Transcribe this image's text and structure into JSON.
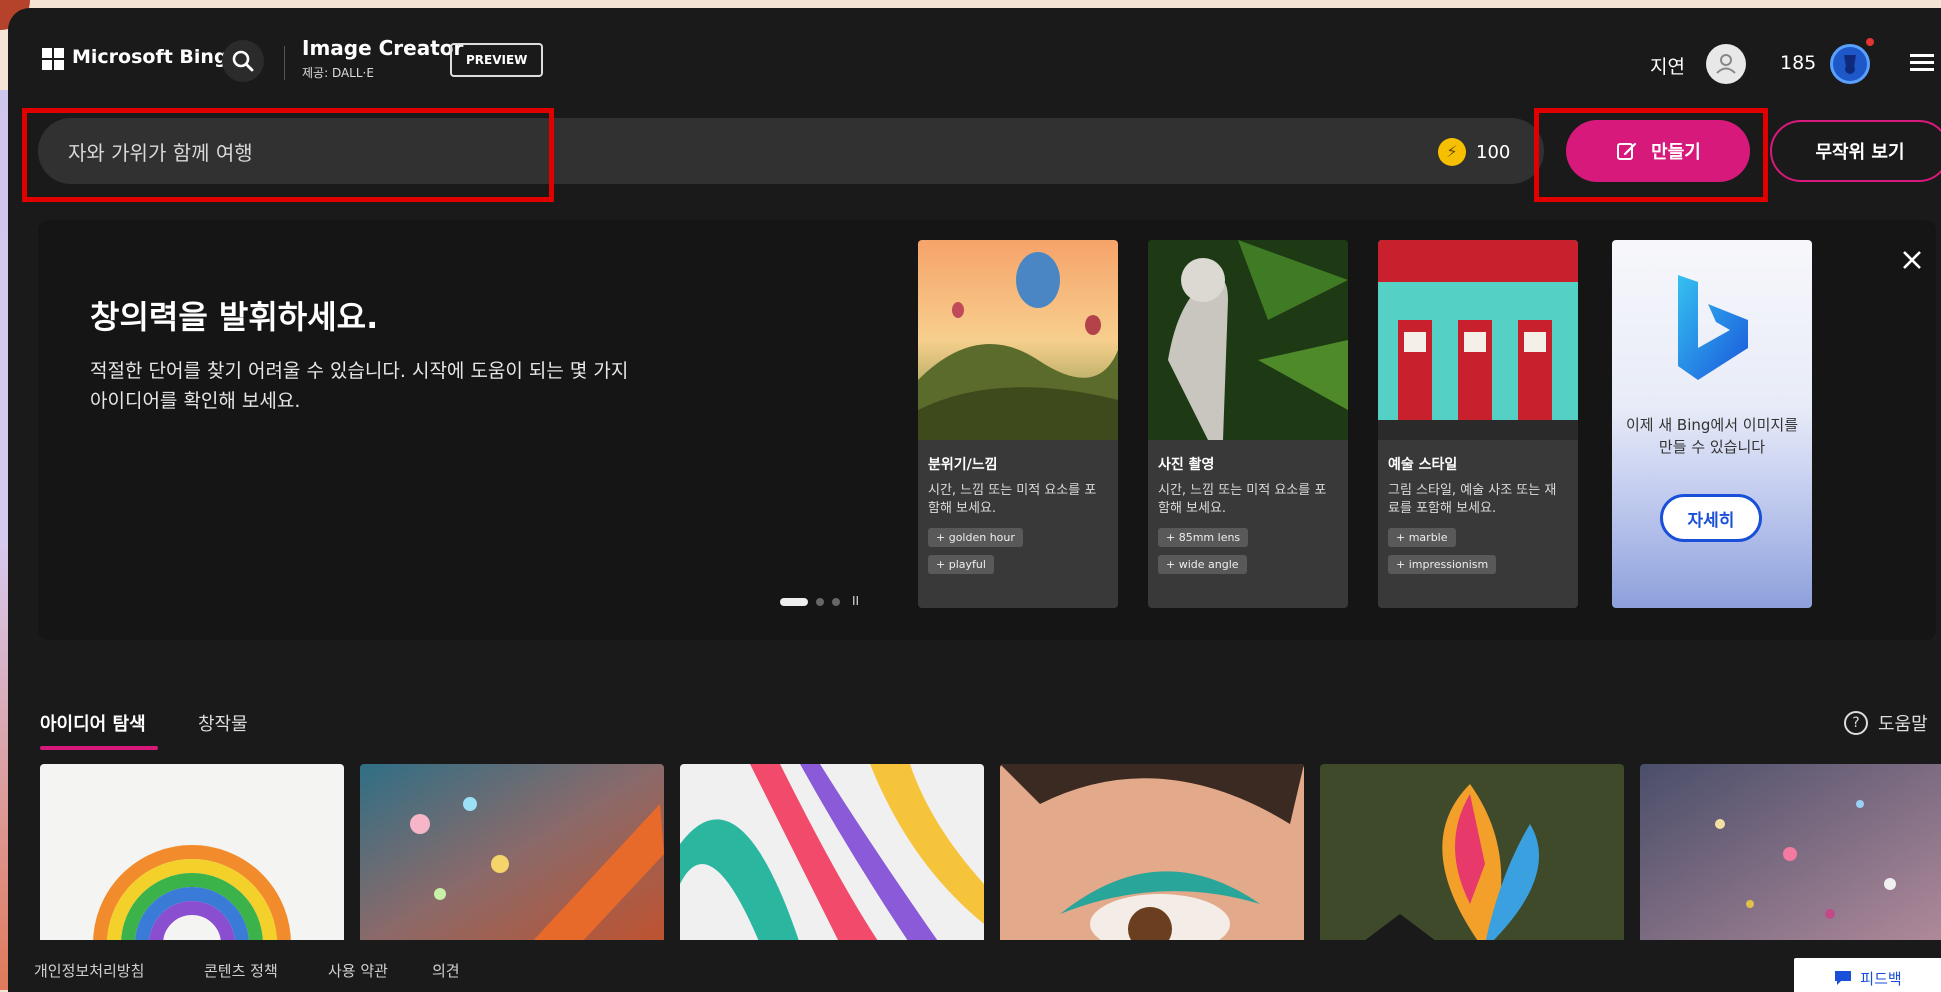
{
  "header": {
    "brand": "Microsoft Bing",
    "product_title": "Image Creator",
    "product_subtitle": "제공: DALL·E",
    "preview_badge": "PREVIEW",
    "username": "지연",
    "coins": "185"
  },
  "prompt": {
    "value": "자와 가위가 함께 여행",
    "boosts": "100",
    "create_label": "만들기",
    "random_label": "무작위 보기"
  },
  "inspire": {
    "title": "창의력을 발휘하세요.",
    "description": "적절한 단어를 찾기 어려울 수 있습니다. 시작에 도움이 되는 몇 가지 아이디어를 확인해 보세요.",
    "cards": [
      {
        "title": "분위기/느낌",
        "description": "시간, 느낌 또는 미적 요소를 포함해 보세요.",
        "chips": [
          "+ golden hour",
          "+ playful"
        ]
      },
      {
        "title": "사진 촬영",
        "description": "시간, 느낌 또는 미적 요소를 포함해 보세요.",
        "chips": [
          "+ 85mm lens",
          "+ wide angle"
        ]
      },
      {
        "title": "예술 스타일",
        "description": "그림 스타일, 예술 사조 또는 재료를 포함해 보세요.",
        "chips": [
          "+ marble",
          "+ impressionism"
        ]
      }
    ],
    "bing_ad": {
      "text": "이제 새 Bing에서 이미지를 만들 수 있습니다",
      "button": "자세히"
    },
    "pause_symbol": "II"
  },
  "tabs": [
    {
      "label": "아이디어 탐색",
      "active": true
    },
    {
      "label": "창작물",
      "active": false
    }
  ],
  "help_label": "도움말",
  "footer": {
    "links": [
      "개인정보처리방침",
      "콘텐츠 정책",
      "사용 약관",
      "의견"
    ],
    "feedback": "피드백"
  },
  "colors": {
    "accent": "#d8197c",
    "background": "#1b1a1a",
    "highlight": "#e00000"
  }
}
